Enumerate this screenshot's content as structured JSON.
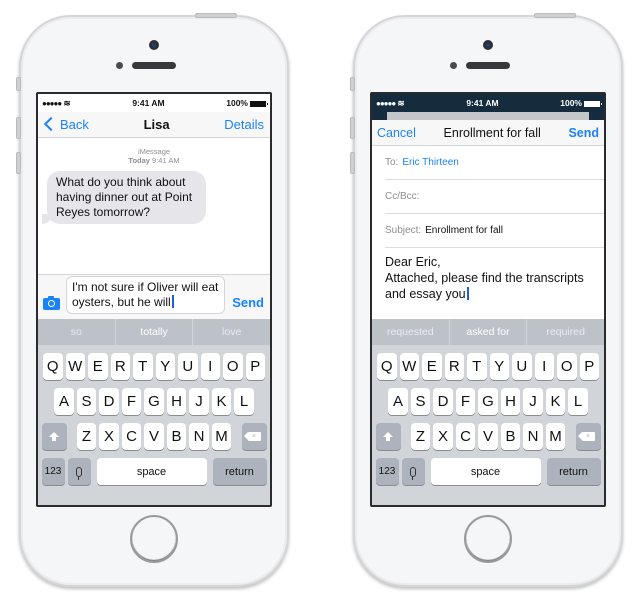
{
  "phones": [
    {
      "app": "Messages",
      "status_bar": {
        "signal": "●●●●●",
        "wifi_icon": "wifi-icon",
        "time": "9:41 AM",
        "battery": "100%"
      },
      "nav": {
        "back_label": "Back",
        "title": "Lisa",
        "action_label": "Details"
      },
      "thread": {
        "service": "iMessage",
        "timestamp_day": "Today",
        "timestamp_time": "9:41 AM",
        "messages": [
          {
            "direction": "incoming",
            "text": "What do you think about having dinner out at Point Reyes tomorrow?"
          }
        ]
      },
      "composer": {
        "camera_icon": "camera-icon",
        "value": "I'm not sure if Oliver will eat oysters, but he will",
        "send_label": "Send"
      },
      "keyboard": {
        "suggestions": [
          "so",
          "totally",
          "love"
        ],
        "rows": [
          [
            "Q",
            "W",
            "E",
            "R",
            "T",
            "Y",
            "U",
            "I",
            "O",
            "P"
          ],
          [
            "A",
            "S",
            "D",
            "F",
            "G",
            "H",
            "J",
            "K",
            "L"
          ],
          [
            "Z",
            "X",
            "C",
            "V",
            "B",
            "N",
            "M"
          ]
        ],
        "numbers_label": "123",
        "space_label": "space",
        "return_label": "return"
      }
    },
    {
      "app": "Mail",
      "status_bar": {
        "signal": "●●●●●",
        "wifi_icon": "wifi-icon",
        "time": "9:41 AM",
        "battery": "100%"
      },
      "nav": {
        "cancel_label": "Cancel",
        "title": "Enrollment for fall",
        "send_label": "Send"
      },
      "fields": {
        "to_label": "To:",
        "to_value": "Eric Thirteen",
        "ccbcc_label": "Cc/Bcc:",
        "subject_label": "Subject:",
        "subject_value": "Enrollment for fall"
      },
      "body": {
        "line1": "Dear Eric,",
        "line2": "Attached, please find the transcripts and essay you"
      },
      "keyboard": {
        "suggestions": [
          "requested",
          "asked for",
          "required"
        ],
        "rows": [
          [
            "Q",
            "W",
            "E",
            "R",
            "T",
            "Y",
            "U",
            "I",
            "O",
            "P"
          ],
          [
            "A",
            "S",
            "D",
            "F",
            "G",
            "H",
            "J",
            "K",
            "L"
          ],
          [
            "Z",
            "X",
            "C",
            "V",
            "B",
            "N",
            "M"
          ]
        ],
        "numbers_label": "123",
        "space_label": "space",
        "return_label": "return"
      }
    }
  ],
  "colors": {
    "accent": "#1a83f8",
    "mail_status_bg": "#152b3e",
    "bubble_incoming": "#e5e5ea",
    "keyboard_bg": "#d1d4d9"
  }
}
